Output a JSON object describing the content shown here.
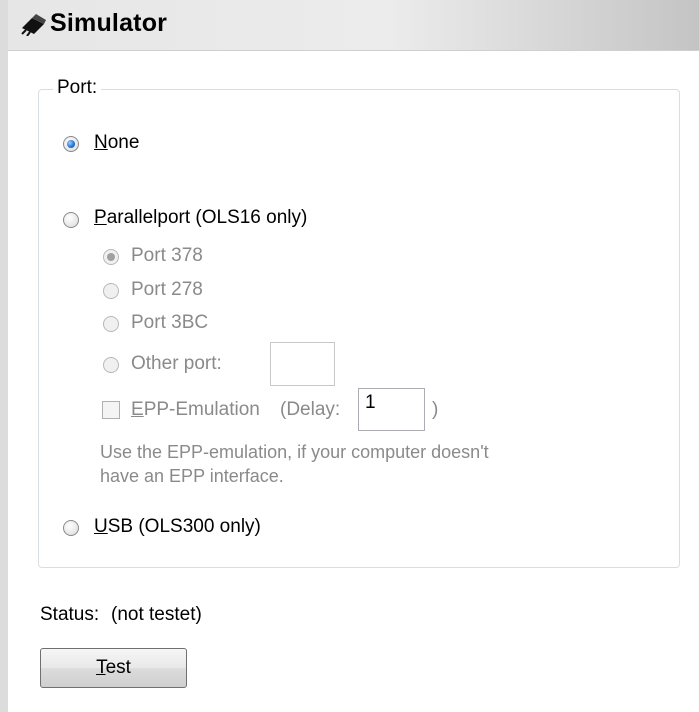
{
  "header": {
    "title": "Simulator",
    "icon": "plug-icon"
  },
  "port_group": {
    "legend": "Port:",
    "none": {
      "mnemonic": "N",
      "rest": "one",
      "checked": true
    },
    "parallel": {
      "mnemonic": "P",
      "rest": "arallelport (OLS16 only)",
      "checked": false
    },
    "parallel_ports": [
      {
        "label": "Port 378",
        "checked": true,
        "enabled": false
      },
      {
        "label": "Port 278",
        "checked": false,
        "enabled": false
      },
      {
        "label": "Port 3BC",
        "checked": false,
        "enabled": false
      }
    ],
    "other_port": {
      "label": "Other port:",
      "value": "",
      "enabled": false
    },
    "epp": {
      "mnemonic": "E",
      "rest": "PP-Emulation",
      "checked": false,
      "enabled": false,
      "delay_label": "(Delay:",
      "delay_value": "1",
      "delay_close": ")"
    },
    "hint_line1": "Use the EPP-emulation, if your computer doesn't",
    "hint_line2": "have an EPP interface.",
    "usb": {
      "mnemonic": "U",
      "rest": "SB (OLS300 only)",
      "checked": false
    }
  },
  "status": {
    "label": "Status:",
    "value": "(not testet)"
  },
  "test_button": {
    "mnemonic": "T",
    "rest": "est"
  }
}
